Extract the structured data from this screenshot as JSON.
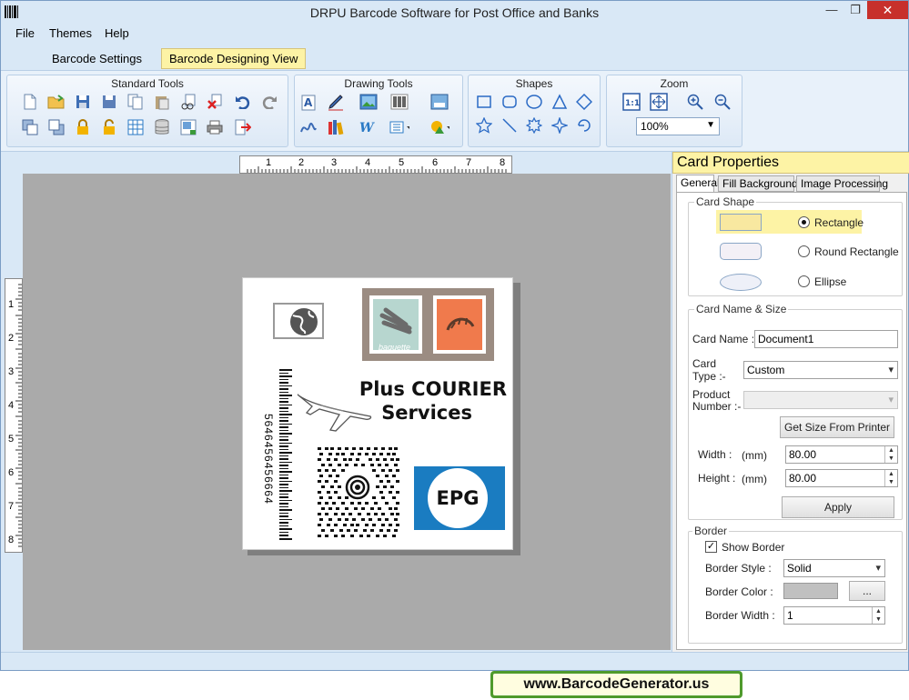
{
  "window": {
    "title": "DRPU Barcode Software for Post Office and Banks"
  },
  "window_controls": {
    "minimize": "—",
    "maximize": "❐",
    "close": "✕"
  },
  "menu": {
    "file": "File",
    "themes": "Themes",
    "help": "Help"
  },
  "subtabs": {
    "barcode_settings": "Barcode Settings",
    "barcode_designing_view": "Barcode Designing View"
  },
  "ribbon": {
    "standard_tools": "Standard Tools",
    "drawing_tools": "Drawing Tools",
    "shapes": "Shapes",
    "zoom": "Zoom",
    "zoom_value": "100%"
  },
  "ruler": {
    "h": [
      "1",
      "2",
      "3",
      "4",
      "5",
      "6",
      "7",
      "8"
    ],
    "v": [
      "1",
      "2",
      "3",
      "4",
      "5",
      "6",
      "7",
      "8"
    ]
  },
  "card": {
    "title_line1": "Plus COURIER",
    "title_line2": "Services",
    "epg": "EPG",
    "barcode_number": "5646456456664",
    "stamp_text": "baguette"
  },
  "panel": {
    "title": "Card Properties",
    "tabs": {
      "general": "General",
      "fill_background": "Fill Background",
      "image_processing": "Image Processing"
    },
    "card_shape": {
      "legend": "Card Shape",
      "rectangle": "Rectangle",
      "round_rectangle": "Round Rectangle",
      "ellipse": "Ellipse",
      "selected": "Rectangle"
    },
    "name_size": {
      "legend": "Card  Name & Size",
      "card_name_label": "Card Name :",
      "card_name_value": "Document1",
      "card_type_label_1": "Card",
      "card_type_label_2": "Type :-",
      "card_type_value": "Custom",
      "product_number_label_1": "Product",
      "product_number_label_2": "Number :-",
      "product_number_value": "",
      "get_size_button": "Get Size From Printer",
      "width_label": "Width :",
      "height_label": "Height :",
      "unit": "(mm)",
      "width_value": "80.00",
      "height_value": "80.00",
      "apply_button": "Apply"
    },
    "border": {
      "legend": "Border",
      "show_border_label": "Show Border",
      "show_border_checked": true,
      "border_style_label": "Border Style :",
      "border_style_value": "Solid",
      "border_color_label": "Border Color :",
      "border_color_value": "#c0c0c0",
      "browse_button": "...",
      "border_width_label": "Border Width :",
      "border_width_value": "1"
    }
  },
  "footer": {
    "url": "www.BarcodeGenerator.us"
  },
  "colors": {
    "accent": "#fdf3a5",
    "window_bg": "#d9e8f6",
    "epg_blue": "#1a7cc1",
    "stamp_teal": "#b7d6cf",
    "stamp_orange": "#f07a4c"
  }
}
